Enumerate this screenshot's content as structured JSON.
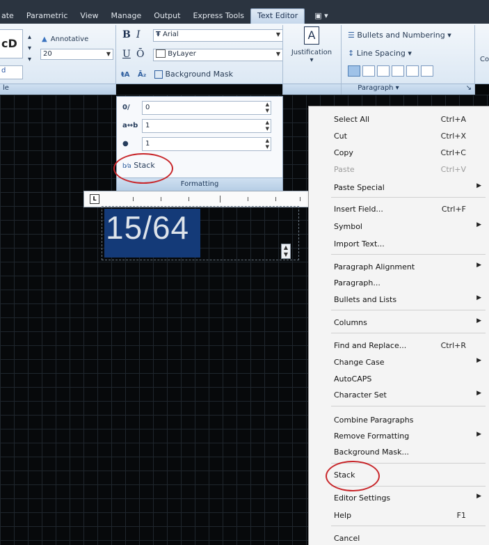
{
  "tabs": [
    "ate",
    "Parametric",
    "View",
    "Manage",
    "Output",
    "Express Tools",
    "Text Editor",
    "▣ ▾"
  ],
  "style_panel": {
    "preview_top": "cD",
    "preview_bottom": "d",
    "annotative_label": "Annotative",
    "text_height": "20",
    "footer": "le"
  },
  "formatting": {
    "bold": "B",
    "italic": "I",
    "underline": "U",
    "overline": "Ō",
    "font": "Arial",
    "color": "ByLayer",
    "background_mask": "Background Mask",
    "oblique_value": "0",
    "tracking_value": "1",
    "width_value": "1",
    "stack_label": "Stack",
    "footer": "Formatting"
  },
  "paragraph": {
    "justification": "Justification",
    "bullets": "Bullets and Numbering",
    "line_spacing": "Line Spacing",
    "footer": "Paragraph ▾",
    "cut_label": "Co"
  },
  "editor": {
    "text": "15/64"
  },
  "menu": [
    {
      "label": "Select All",
      "shortcut": "Ctrl+A"
    },
    {
      "label": "Cut",
      "shortcut": "Ctrl+X"
    },
    {
      "label": "Copy",
      "shortcut": "Ctrl+C"
    },
    {
      "label": "Paste",
      "shortcut": "Ctrl+V"
    },
    {
      "label": "Paste Special",
      "shortcut": ""
    },
    {
      "label": "Insert Field...",
      "shortcut": "Ctrl+F"
    },
    {
      "label": "Symbol",
      "shortcut": ""
    },
    {
      "label": "Import Text...",
      "shortcut": ""
    },
    {
      "label": "Paragraph Alignment",
      "shortcut": ""
    },
    {
      "label": "Paragraph...",
      "shortcut": ""
    },
    {
      "label": "Bullets and Lists",
      "shortcut": ""
    },
    {
      "label": "Columns",
      "shortcut": ""
    },
    {
      "label": "Find and Replace...",
      "shortcut": "Ctrl+R"
    },
    {
      "label": "Change Case",
      "shortcut": ""
    },
    {
      "label": "AutoCAPS",
      "shortcut": ""
    },
    {
      "label": "Character Set",
      "shortcut": ""
    },
    {
      "label": "Combine Paragraphs",
      "shortcut": ""
    },
    {
      "label": "Remove Formatting",
      "shortcut": ""
    },
    {
      "label": "Background Mask...",
      "shortcut": ""
    },
    {
      "label": "Stack",
      "shortcut": ""
    },
    {
      "label": "Editor Settings",
      "shortcut": ""
    },
    {
      "label": "Help",
      "shortcut": "F1"
    },
    {
      "label": "Cancel",
      "shortcut": ""
    }
  ]
}
